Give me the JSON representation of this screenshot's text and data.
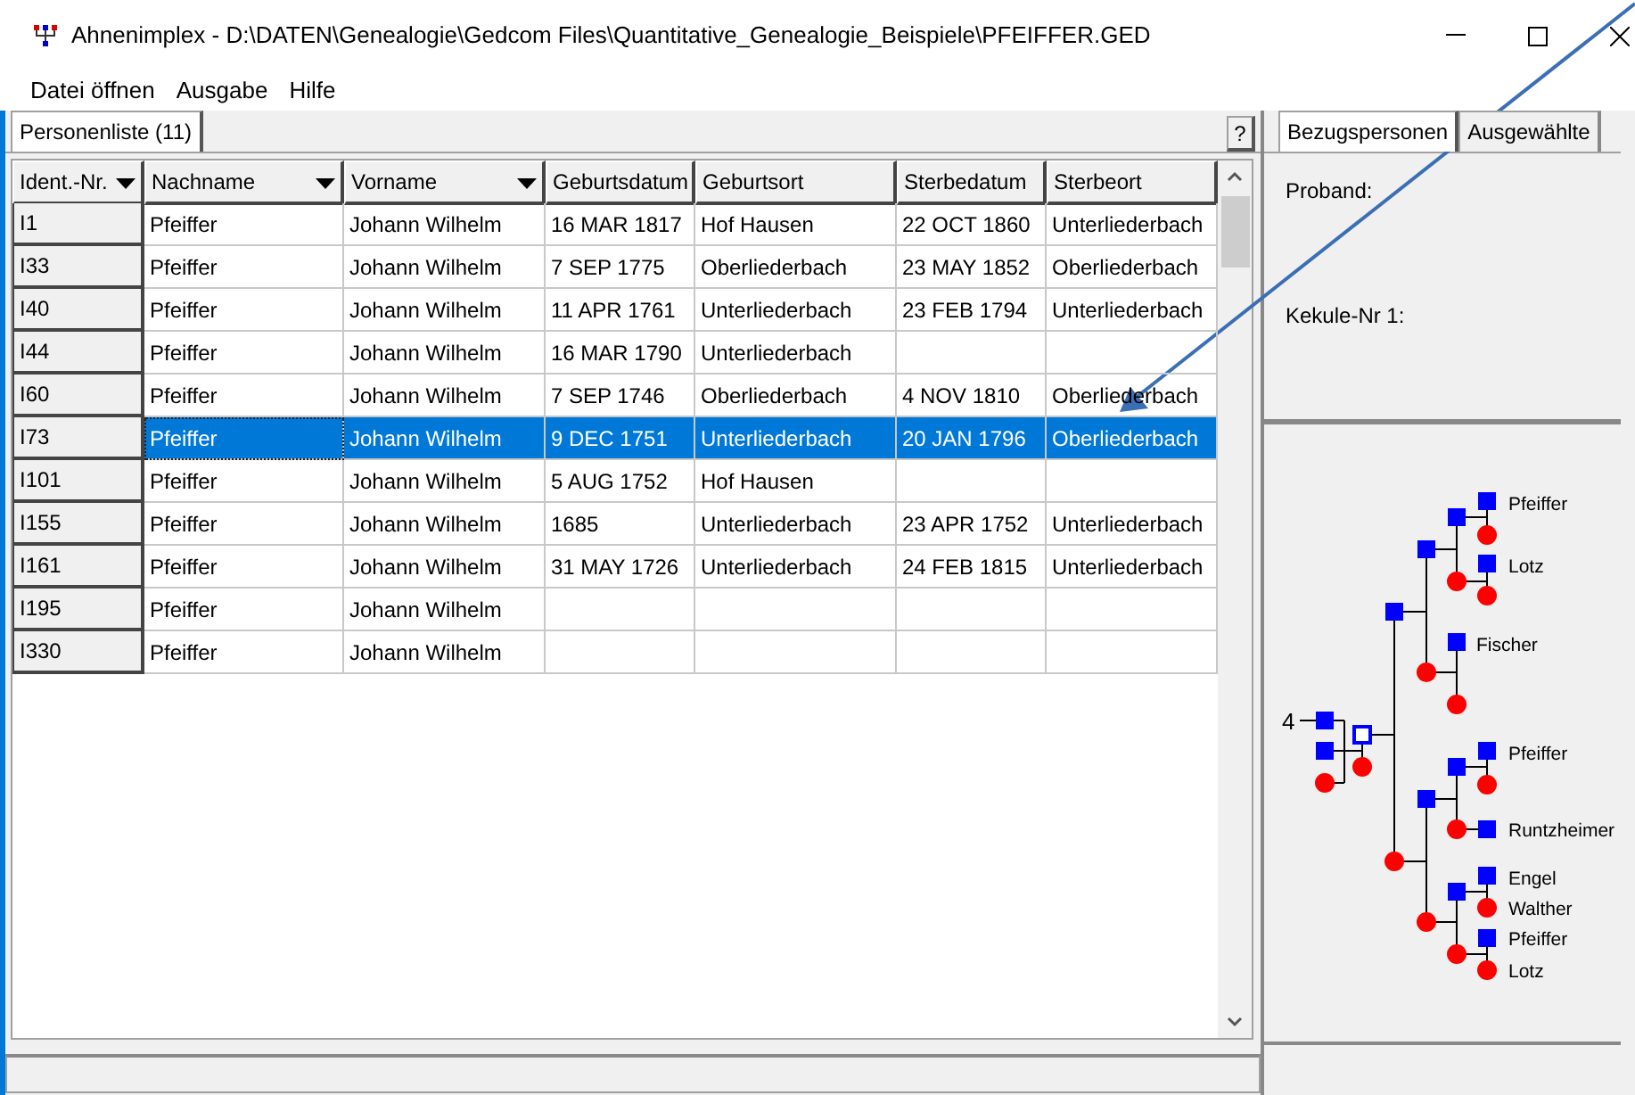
{
  "window": {
    "title": "Ahnenimplex - D:\\DATEN\\Genealogie\\Gedcom Files\\Quantitative_Genealogie_Beispiele\\PFEIFFER.GED"
  },
  "menu": [
    "Datei öffnen",
    "Ausgabe",
    "Hilfe"
  ],
  "left_tabs": [
    {
      "label": "Personenliste (11)",
      "selected": true
    }
  ],
  "help_button": "?",
  "table": {
    "columns": [
      {
        "label": "Ident.-Nr.",
        "dropdown": true
      },
      {
        "label": "Nachname",
        "dropdown": true
      },
      {
        "label": "Vorname",
        "dropdown": true
      },
      {
        "label": "Geburtsdatum",
        "dropdown": false
      },
      {
        "label": "Geburtsort",
        "dropdown": false
      },
      {
        "label": "Sterbedatum",
        "dropdown": false
      },
      {
        "label": "Sterbeort",
        "dropdown": false
      }
    ],
    "rows": [
      {
        "selected": false,
        "cells": [
          "I1",
          "Pfeiffer",
          "Johann Wilhelm",
          "16 MAR 1817",
          "Hof Hausen",
          "22 OCT 1860",
          "Unterliederbach"
        ]
      },
      {
        "selected": false,
        "cells": [
          "I33",
          "Pfeiffer",
          "Johann Wilhelm",
          "7 SEP 1775",
          "Oberliederbach",
          "23 MAY 1852",
          "Oberliederbach"
        ]
      },
      {
        "selected": false,
        "cells": [
          "I40",
          "Pfeiffer",
          "Johann Wilhelm",
          "11 APR 1761",
          "Unterliederbach",
          "23 FEB 1794",
          "Unterliederbach"
        ]
      },
      {
        "selected": false,
        "cells": [
          "I44",
          "Pfeiffer",
          "Johann Wilhelm",
          "16 MAR 1790",
          "Unterliederbach",
          "",
          ""
        ]
      },
      {
        "selected": false,
        "cells": [
          "I60",
          "Pfeiffer",
          "Johann Wilhelm",
          "7 SEP 1746",
          "Oberliederbach",
          "4 NOV 1810",
          "Oberliederbach"
        ]
      },
      {
        "selected": true,
        "cells": [
          "I73",
          "Pfeiffer",
          "Johann Wilhelm",
          "9 DEC 1751",
          "Unterliederbach",
          "20 JAN 1796",
          "Oberliederbach"
        ]
      },
      {
        "selected": false,
        "cells": [
          "I101",
          "Pfeiffer",
          "Johann Wilhelm",
          "5 AUG 1752",
          "Hof Hausen",
          "",
          ""
        ]
      },
      {
        "selected": false,
        "cells": [
          "I155",
          "Pfeiffer",
          "Johann Wilhelm",
          "1685",
          "Unterliederbach",
          "23 APR 1752",
          "Unterliederbach"
        ]
      },
      {
        "selected": false,
        "cells": [
          "I161",
          "Pfeiffer",
          "Johann Wilhelm",
          "31 MAY 1726",
          "Unterliederbach",
          "24 FEB 1815",
          "Unterliederbach"
        ]
      },
      {
        "selected": false,
        "cells": [
          "I195",
          "Pfeiffer",
          "Johann Wilhelm",
          "",
          "",
          "",
          ""
        ]
      },
      {
        "selected": false,
        "cells": [
          "I330",
          "Pfeiffer",
          "Johann Wilhelm",
          "",
          "",
          "",
          ""
        ]
      }
    ]
  },
  "right_tabs": [
    {
      "label": "Bezugspersonen",
      "selected": true
    },
    {
      "label": "Ausgewählte",
      "selected": false
    }
  ],
  "reference": {
    "fields": [
      "Proband:",
      "Kekule-Nr 1:"
    ]
  },
  "pedigree": {
    "generation_label": "4",
    "names": [
      "Pfeiffer",
      "Lotz",
      "Fischer",
      "Pfeiffer",
      "Runtzheimer",
      "Engel",
      "Walther",
      "Pfeiffer",
      "Lotz"
    ]
  }
}
